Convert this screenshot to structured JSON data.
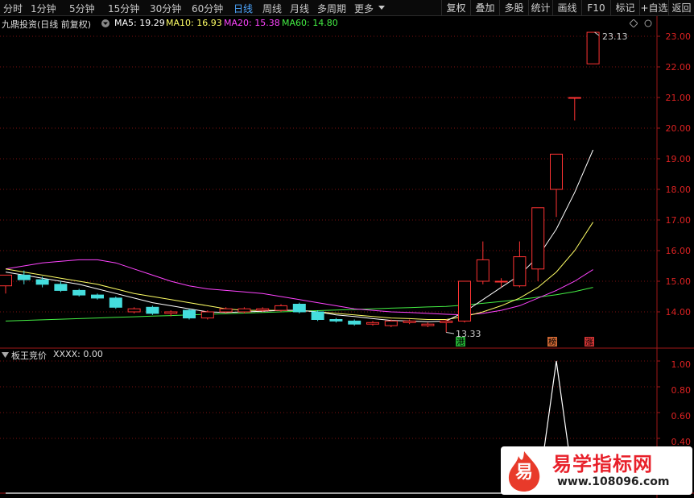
{
  "toolbar": {
    "periods": [
      "分时",
      "1分钟",
      "5分钟",
      "15分钟",
      "30分钟",
      "60分钟",
      "日线",
      "周线",
      "月线",
      "多周期",
      "更多"
    ],
    "active_period": "日线",
    "more_icon": "triangle-down",
    "buttons": [
      "复权",
      "叠加",
      "多股",
      "统计",
      "画线",
      "F10",
      "标记",
      "+自选",
      "返回"
    ]
  },
  "main_panel": {
    "stock_label": "九鼎投资(日线 前复权)",
    "ma_labels": [
      {
        "text": "MA5: 19.29",
        "color": "#ffffff"
      },
      {
        "text": "MA10: 16.93",
        "color": "#ffff66"
      },
      {
        "text": "MA20: 15.38",
        "color": "#ff44ff"
      },
      {
        "text": "MA60: 14.80",
        "color": "#44ee44"
      }
    ],
    "price_ticks": [
      "23.00",
      "22.00",
      "21.00",
      "20.00",
      "19.00",
      "18.00",
      "17.00",
      "16.00",
      "15.00",
      "14.00"
    ],
    "high_annotation": "23.13",
    "low_annotation": "13.33",
    "tags": [
      {
        "text": "港",
        "color": "#22aa33"
      },
      {
        "text": "榜",
        "color": "#cc6633"
      },
      {
        "text": "涨",
        "color": "#cc3333"
      }
    ]
  },
  "sub_panel": {
    "indicator_label": "板王竞价",
    "value_label": "XXXX: 0.00",
    "ticks": [
      "1.00",
      "0.80",
      "0.60",
      "0.40"
    ]
  },
  "watermark": {
    "title": "易学指标网",
    "url": "www.108096.com",
    "logo_char": "易"
  },
  "chart_data": {
    "type": "candlestick",
    "ylim": [
      13.2,
      23.4
    ],
    "candles": [
      {
        "o": 14.85,
        "h": 15.1,
        "l": 14.6,
        "c": 15.2
      },
      {
        "o": 15.2,
        "h": 15.35,
        "l": 14.9,
        "c": 15.05
      },
      {
        "o": 15.05,
        "h": 15.15,
        "l": 14.8,
        "c": 14.9
      },
      {
        "o": 14.9,
        "h": 15.0,
        "l": 14.65,
        "c": 14.7
      },
      {
        "o": 14.7,
        "h": 14.75,
        "l": 14.5,
        "c": 14.55
      },
      {
        "o": 14.55,
        "h": 14.6,
        "l": 14.4,
        "c": 14.45
      },
      {
        "o": 14.45,
        "h": 14.5,
        "l": 14.1,
        "c": 14.15
      },
      {
        "o": 14.0,
        "h": 14.15,
        "l": 13.95,
        "c": 14.1
      },
      {
        "o": 14.15,
        "h": 14.2,
        "l": 13.9,
        "c": 13.95
      },
      {
        "o": 13.95,
        "h": 14.05,
        "l": 13.85,
        "c": 14.0
      },
      {
        "o": 14.05,
        "h": 14.1,
        "l": 13.75,
        "c": 13.8
      },
      {
        "o": 13.8,
        "h": 14.05,
        "l": 13.75,
        "c": 14.0
      },
      {
        "o": 14.0,
        "h": 14.15,
        "l": 13.95,
        "c": 14.1
      },
      {
        "o": 14.0,
        "h": 14.15,
        "l": 13.95,
        "c": 14.1
      },
      {
        "o": 14.05,
        "h": 14.15,
        "l": 14.0,
        "c": 14.1
      },
      {
        "o": 14.05,
        "h": 14.25,
        "l": 14.0,
        "c": 14.2
      },
      {
        "o": 14.25,
        "h": 14.3,
        "l": 13.95,
        "c": 14.0
      },
      {
        "o": 14.0,
        "h": 14.05,
        "l": 13.7,
        "c": 13.75
      },
      {
        "o": 13.75,
        "h": 13.8,
        "l": 13.65,
        "c": 13.7
      },
      {
        "o": 13.7,
        "h": 13.75,
        "l": 13.55,
        "c": 13.6
      },
      {
        "o": 13.6,
        "h": 13.7,
        "l": 13.55,
        "c": 13.65
      },
      {
        "o": 13.55,
        "h": 13.75,
        "l": 13.5,
        "c": 13.7
      },
      {
        "o": 13.65,
        "h": 13.75,
        "l": 13.6,
        "c": 13.7
      },
      {
        "o": 13.55,
        "h": 13.65,
        "l": 13.5,
        "c": 13.6
      },
      {
        "o": 13.65,
        "h": 13.75,
        "l": 13.33,
        "c": 13.7
      },
      {
        "o": 13.7,
        "h": 15.0,
        "l": 13.65,
        "c": 15.0
      },
      {
        "o": 15.0,
        "h": 16.3,
        "l": 14.9,
        "c": 15.7
      },
      {
        "o": 15.0,
        "h": 15.1,
        "l": 14.8,
        "c": 15.0
      },
      {
        "o": 14.85,
        "h": 16.3,
        "l": 14.8,
        "c": 15.8
      },
      {
        "o": 15.4,
        "h": 17.4,
        "l": 15.0,
        "c": 17.4
      },
      {
        "o": 18.0,
        "h": 19.15,
        "l": 17.1,
        "c": 19.15
      },
      {
        "o": 21.0,
        "h": 21.0,
        "l": 20.25,
        "c": 21.0
      },
      {
        "o": 22.1,
        "h": 23.13,
        "l": 22.1,
        "c": 23.13
      }
    ],
    "ma5": [
      15.3,
      15.2,
      15.1,
      15.0,
      14.9,
      14.75,
      14.6,
      14.45,
      14.3,
      14.2,
      14.1,
      14.0,
      13.98,
      14.0,
      14.02,
      14.05,
      14.05,
      14.0,
      13.9,
      13.85,
      13.78,
      13.72,
      13.7,
      13.68,
      13.7,
      14.0,
      14.4,
      14.8,
      15.2,
      15.8,
      16.7,
      17.9,
      19.29
    ],
    "ma10": [
      15.4,
      15.3,
      15.2,
      15.1,
      15.0,
      14.9,
      14.75,
      14.6,
      14.5,
      14.4,
      14.3,
      14.2,
      14.1,
      14.05,
      14.05,
      14.05,
      14.05,
      14.0,
      13.95,
      13.9,
      13.85,
      13.8,
      13.78,
      13.75,
      13.75,
      13.85,
      14.0,
      14.2,
      14.45,
      14.8,
      15.3,
      16.0,
      16.93
    ],
    "ma20": [
      15.4,
      15.5,
      15.6,
      15.65,
      15.7,
      15.7,
      15.6,
      15.4,
      15.2,
      15.0,
      14.85,
      14.75,
      14.7,
      14.65,
      14.6,
      14.5,
      14.4,
      14.3,
      14.2,
      14.1,
      14.05,
      14.0,
      13.98,
      13.95,
      13.92,
      13.9,
      13.95,
      14.05,
      14.2,
      14.45,
      14.7,
      15.0,
      15.38
    ],
    "ma60": [
      13.7,
      13.72,
      13.74,
      13.76,
      13.78,
      13.8,
      13.82,
      13.84,
      13.86,
      13.88,
      13.9,
      13.92,
      13.94,
      13.96,
      13.98,
      14.0,
      14.02,
      14.04,
      14.06,
      14.08,
      14.1,
      14.12,
      14.14,
      14.16,
      14.18,
      14.22,
      14.28,
      14.34,
      14.4,
      14.48,
      14.56,
      14.66,
      14.8
    ],
    "sub_values": [
      0,
      0,
      0,
      0,
      0,
      0,
      0,
      0,
      0,
      0,
      0,
      0,
      0,
      0,
      0,
      0,
      0,
      0,
      0,
      0,
      0,
      0,
      0,
      0,
      0,
      0,
      0,
      0,
      0,
      0,
      1.0,
      0,
      0
    ],
    "sub_ylim": [
      0,
      1.05
    ],
    "up_color": "#ff3333",
    "down_color": "#44dddd"
  }
}
